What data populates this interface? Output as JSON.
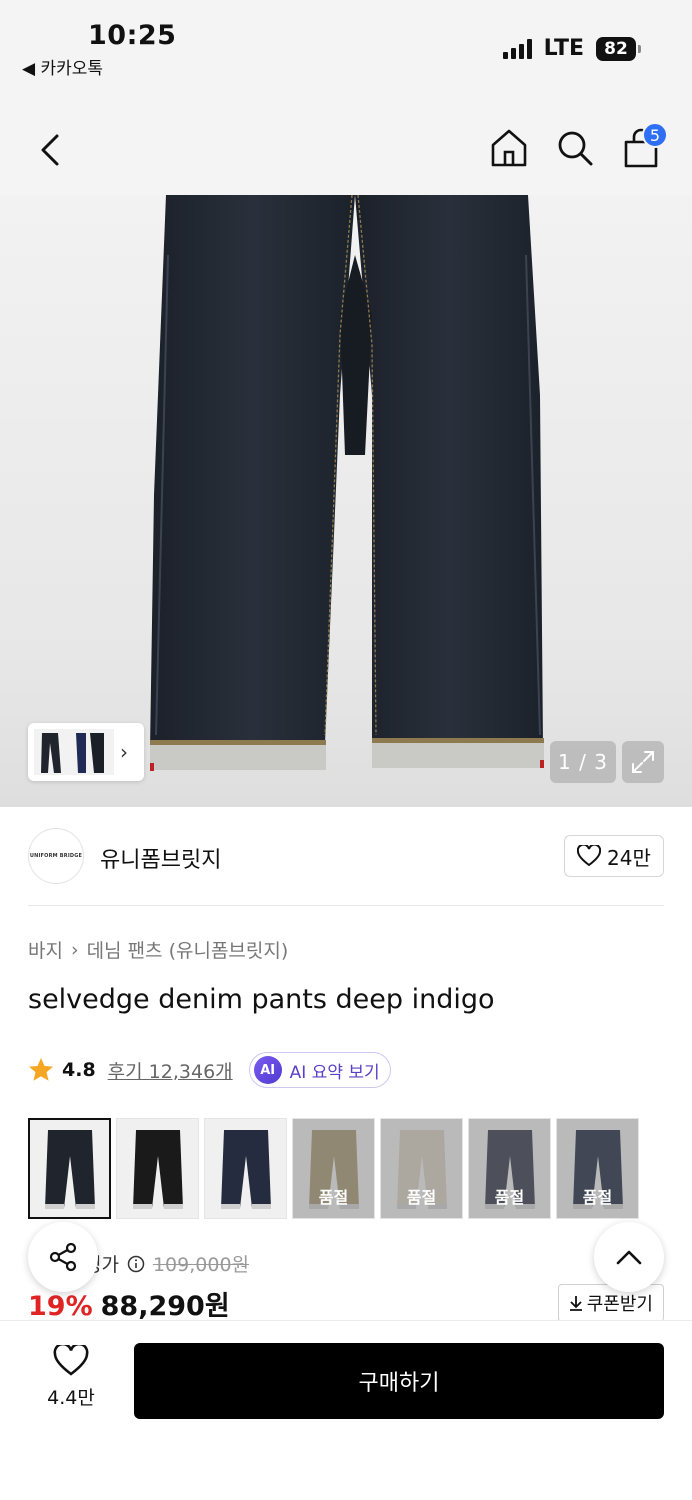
{
  "status_bar": {
    "time": "10:25",
    "back_app": "◀ 카카오톡",
    "network": "LTE",
    "battery": "82"
  },
  "nav": {
    "cart_badge": "5",
    "icons": [
      "back-icon",
      "home-icon",
      "search-icon",
      "cart-icon"
    ]
  },
  "gallery": {
    "pager": "1 / 3"
  },
  "brand": {
    "logo_text": "UNIFORM BRIDGE",
    "name": "유니폼브릿지",
    "likes": "24만"
  },
  "breadcrumb": [
    "바지",
    "데님 팬츠 (유니폼브릿지)"
  ],
  "product": {
    "title": "selvedge denim pants deep indigo"
  },
  "rating": {
    "score": "4.8",
    "reviews": "후기 12,346개",
    "ai_badge": "AI",
    "ai_summary": "AI 요약 보기"
  },
  "swatches": [
    {
      "color": "#1f242d",
      "soldout": false,
      "selected": true
    },
    {
      "color": "#1a1a1a",
      "soldout": false,
      "selected": false
    },
    {
      "color": "#252c3f",
      "soldout": false,
      "selected": false
    },
    {
      "color": "#a69572",
      "soldout": true,
      "label": "품절"
    },
    {
      "color": "#d8d0c2",
      "soldout": true,
      "label": "품절"
    },
    {
      "color": "#2a3042",
      "soldout": true,
      "label": "품절"
    },
    {
      "color": "#17203a",
      "soldout": true,
      "label": "품절"
    }
  ],
  "price": {
    "label": "정가",
    "original": "109,000원",
    "discount": "19%",
    "sale": "88,290원",
    "coupon": "쿠폰받기"
  },
  "bottom": {
    "wish_count": "4.4만",
    "buy_label": "구매하기"
  },
  "colors": {
    "accent_red": "#e02424",
    "badge_blue": "#2f6ff5",
    "ai_purple": "#5b3fc7"
  }
}
